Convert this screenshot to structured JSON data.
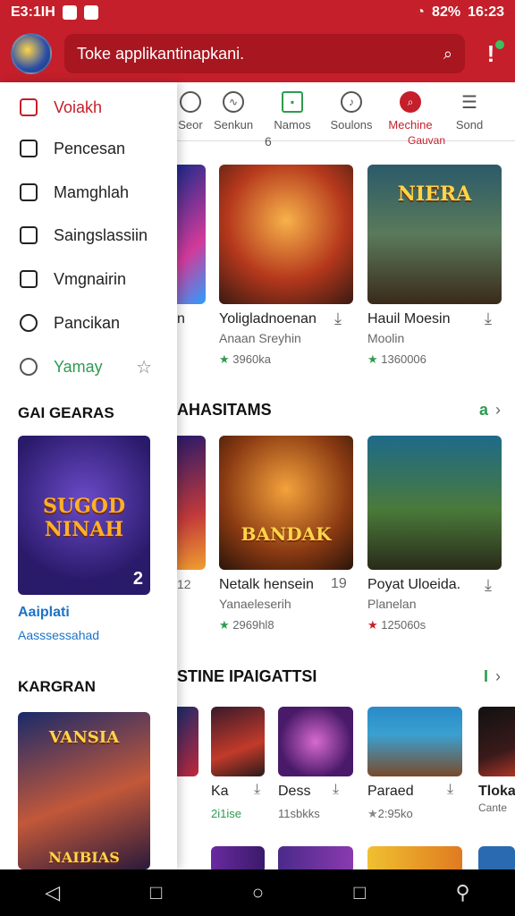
{
  "status": {
    "carrier": "E3:1IH",
    "battery": "82%",
    "time": "16:23"
  },
  "header": {
    "search_placeholder": "Toke applikantinapkani."
  },
  "tabs": [
    {
      "label": "Seor",
      "icon": "clock-icon"
    },
    {
      "label": "Senkun",
      "icon": "squiggle-icon"
    },
    {
      "label": "Namos",
      "icon": "grid-icon"
    },
    {
      "label": "Soulons",
      "icon": "music-icon"
    },
    {
      "label": "Mechine",
      "icon": "search-icon",
      "active": true
    },
    {
      "label": "Sond",
      "icon": "menu-icon"
    }
  ],
  "tab_subtitle": "Gauvan",
  "tab_glyph": "6",
  "row1": [
    {
      "title": "Yoligladnoenan",
      "sub": "Anaan Sreyhin",
      "rating": "3960ka",
      "art": ""
    },
    {
      "title": "Hauil Moesin",
      "sub": "Moolin",
      "rating": "1360006",
      "art": "NIERA"
    }
  ],
  "row1_partial_title": "n",
  "section2": {
    "title": "AHASITAMS",
    "flag": "a"
  },
  "row2": [
    {
      "title": "Netalk hensein",
      "sub": "Yanaeleserih",
      "rating": "2969hl8",
      "badge": "19",
      "art": "BANDAK"
    },
    {
      "title": "Poyat Uloeida.",
      "sub": "Planelan",
      "rating": "125060s",
      "art": ""
    }
  ],
  "row2_partial_badge": "12",
  "section3": {
    "title": "STINE IPAIGATTSI",
    "flag": "I"
  },
  "row3": [
    {
      "title": "Ka",
      "rating": "2i1ise"
    },
    {
      "title": "Dess",
      "rating": "11sbkks"
    },
    {
      "title": "Paraed",
      "rating": "2:95ko"
    },
    {
      "title": "Tlokaf",
      "sub": "Cante"
    }
  ],
  "drawer": {
    "items": [
      {
        "label": "Voiakh",
        "icon": "home-icon",
        "active": true
      },
      {
        "label": "Pencesan",
        "icon": "house-icon"
      },
      {
        "label": "Mamghlah",
        "icon": "bag-icon"
      },
      {
        "label": "Saingslassiin",
        "icon": "list-icon"
      },
      {
        "label": "Vmgnairin",
        "icon": "shield-icon"
      },
      {
        "label": "Pancikan",
        "icon": "search-icon"
      },
      {
        "label": "Yamay",
        "icon": "target-icon",
        "green": true
      }
    ],
    "section1": "GAI GEARAS",
    "card1_art": "SUGOD NINAH",
    "card1_badge": "2",
    "card1_title": "Aaiplati",
    "card1_sub": "Aasssessahad",
    "section2": "KARGRAN",
    "card2_art": "VANSIA",
    "card2_footer": "NAIBIAS"
  },
  "colors": {
    "brand": "#c41f2a",
    "accent_green": "#2e9b4f",
    "link_blue": "#1a73c8"
  }
}
